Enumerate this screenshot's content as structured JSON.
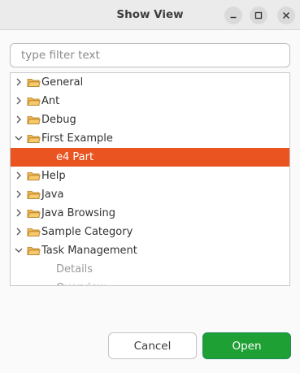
{
  "window": {
    "title": "Show View"
  },
  "filter": {
    "placeholder": "type filter text",
    "value": ""
  },
  "tree": {
    "items": [
      {
        "label": "General",
        "type": "category",
        "expanded": false,
        "icon": "folder-icon"
      },
      {
        "label": "Ant",
        "type": "category",
        "expanded": false,
        "icon": "folder-icon"
      },
      {
        "label": "Debug",
        "type": "category",
        "expanded": false,
        "icon": "folder-icon"
      },
      {
        "label": "First Example",
        "type": "category",
        "expanded": true,
        "icon": "folder-icon"
      },
      {
        "label": "e4 Part",
        "type": "view",
        "selected": true
      },
      {
        "label": "Help",
        "type": "category",
        "expanded": false,
        "icon": "folder-icon"
      },
      {
        "label": "Java",
        "type": "category",
        "expanded": false,
        "icon": "folder-icon"
      },
      {
        "label": "Java Browsing",
        "type": "category",
        "expanded": false,
        "icon": "folder-icon"
      },
      {
        "label": "Sample Category",
        "type": "category",
        "expanded": false,
        "icon": "folder-icon"
      },
      {
        "label": "Task Management",
        "type": "category",
        "expanded": true,
        "icon": "folder-icon"
      },
      {
        "label": "Details",
        "type": "view",
        "selected": false
      },
      {
        "label": "Overview",
        "type": "view",
        "selected": false
      }
    ]
  },
  "buttons": {
    "cancel": "Cancel",
    "open": "Open"
  },
  "colors": {
    "selection": "#e95420",
    "primary_button": "#1ea034",
    "folder": "#e9a23b"
  }
}
